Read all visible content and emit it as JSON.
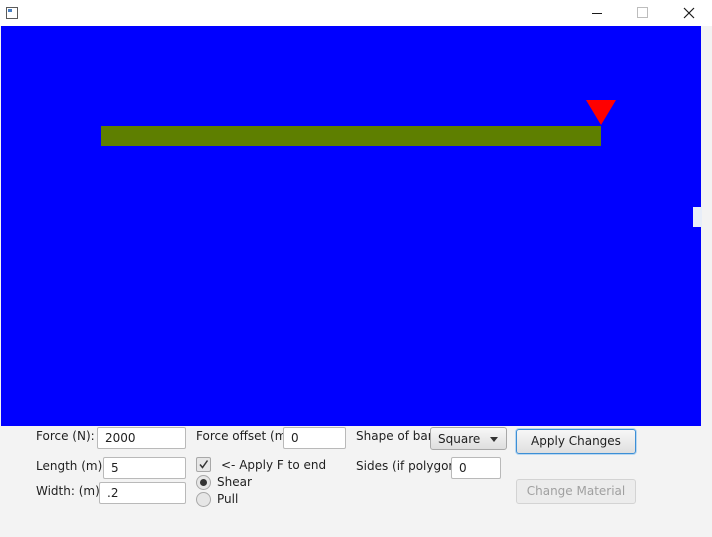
{
  "window": {
    "controls": {
      "minimize_icon": "minimize-icon",
      "maximize_icon": "maximize-icon",
      "close_icon": "close-icon"
    }
  },
  "canvas": {
    "background_color": "#0000ff",
    "bar_color": "#5e7f00",
    "force_arrow_color": "#ff0000"
  },
  "controls": {
    "force": {
      "label": "Force (N):",
      "value": "2000"
    },
    "length": {
      "label": "Length (m):",
      "value": "5"
    },
    "width": {
      "label": "Width: (m)",
      "value": ".2"
    },
    "force_offset": {
      "label": "Force offset (m):",
      "value": "0"
    },
    "apply_to_end": {
      "label": "<- Apply F to end",
      "checked": true
    },
    "load_type": {
      "options": [
        {
          "label": "Shear",
          "selected": true
        },
        {
          "label": "Pull",
          "selected": false
        }
      ]
    },
    "shape": {
      "label": "Shape of bar:",
      "value": "Square"
    },
    "sides": {
      "label": "Sides (if polygon):",
      "value": "0"
    },
    "apply_button": "Apply Changes",
    "material_button": "Change Material"
  }
}
